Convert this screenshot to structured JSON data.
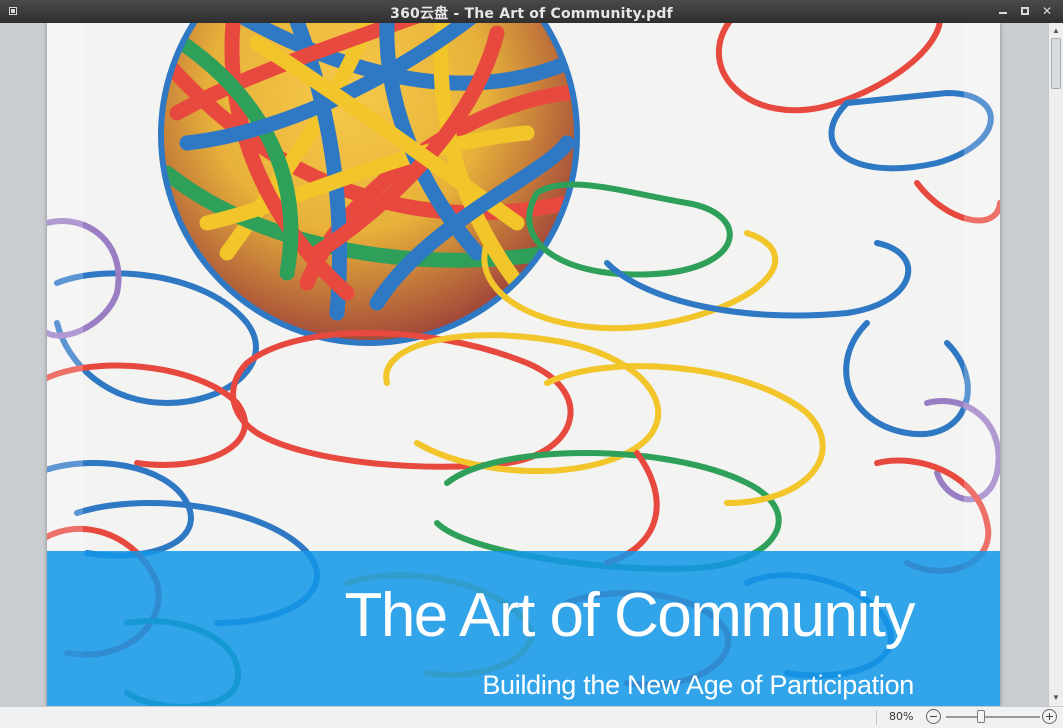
{
  "window": {
    "title": "360云盘 - The Art of Community.pdf",
    "close_glyph": "✕"
  },
  "document": {
    "cover_title": "The Art of Community",
    "cover_subtitle": "Building the New Age of Participation",
    "cover_image": "rubber-band-ball-and-loose-rubber-bands",
    "banner_color": "#1296e8"
  },
  "scrollbar": {
    "up_glyph": "▲",
    "down_glyph": "▼"
  },
  "statusbar": {
    "zoom_level": "80%"
  },
  "colors": {
    "titlebar": "#3a3a3a",
    "rubber_bands": [
      "#e8493f",
      "#f2c52a",
      "#2f78c4",
      "#2fa05a",
      "#9a7ec4"
    ]
  },
  "icons": [
    "app-menu-icon",
    "minimize-icon",
    "maximize-icon",
    "close-icon",
    "zoom-out-icon",
    "zoom-in-icon",
    "scroll-up-icon",
    "scroll-down-icon"
  ]
}
